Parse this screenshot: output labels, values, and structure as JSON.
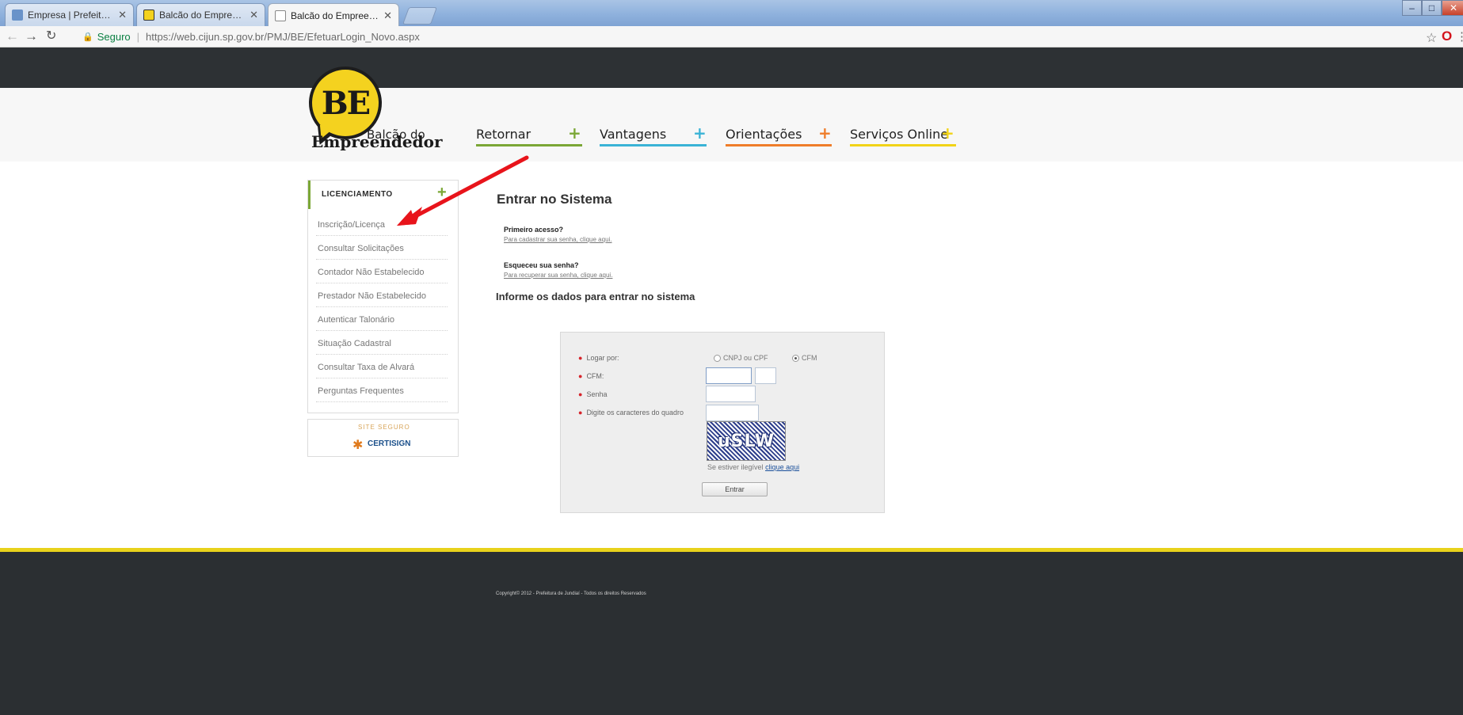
{
  "browser": {
    "tabs": [
      {
        "title": "Empresa | Prefeitura de"
      },
      {
        "title": "Balcão do Empreendedo"
      },
      {
        "title": "Balcão do Empreendedo"
      }
    ],
    "address": {
      "secure_label": "Seguro",
      "url": "https://web.cijun.sp.gov.br/PMJ/BE/EfetuarLogin_Novo.aspx"
    }
  },
  "logo": {
    "mark": "BE",
    "line1": "Balcão do",
    "line2": "Empreendedor"
  },
  "nav": {
    "items": [
      {
        "label": "Retornar",
        "color": "#7ba736"
      },
      {
        "label": "Vantagens",
        "color": "#3ab3d6"
      },
      {
        "label": "Orientações",
        "color": "#ef7d2a"
      },
      {
        "label": "Serviços Online",
        "color": "#f1d317"
      }
    ],
    "plus": "+"
  },
  "sidebar": {
    "header": "LICENCIAMENTO",
    "plus": "+",
    "items": [
      {
        "label": "Inscrição/Licença"
      },
      {
        "label": "Consultar Solicitações"
      },
      {
        "label": "Contador Não Estabelecido"
      },
      {
        "label": "Prestador Não Estabelecido"
      },
      {
        "label": "Autenticar Talonário"
      },
      {
        "label": "Situação Cadastral"
      },
      {
        "label": "Consultar Taxa de Alvará"
      },
      {
        "label": "Perguntas Frequentes"
      }
    ]
  },
  "badge": {
    "top": "SITE SEGURO",
    "name": "CERTISIGN"
  },
  "main": {
    "title": "Entrar no Sistema",
    "first_access_title": "Primeiro acesso?",
    "first_access_link": "Para cadastrar sua senha, clique aqui.",
    "forgot_title": "Esqueceu sua senha?",
    "forgot_link": "Para recuperar sua senha, clique aqui.",
    "info_title": "Informe os dados para entrar no sistema"
  },
  "login": {
    "label_logar": "Logar por:",
    "option_cnpj": "CNPJ ou CPF",
    "option_cfm": "CFM",
    "selected": "CFM",
    "label_cfm": "CFM:",
    "label_senha": "Senha",
    "label_captcha": "Digite os caracteres do quadro",
    "captcha_text": "uSLW",
    "captcha_note": "Se estiver ilegível",
    "captcha_link": "clique aqui",
    "button_enter": "Entrar"
  },
  "footer": {
    "copyright": "Copyright© 2012 - Prefeitura de Jundiaí - Todos os direitos Reservados"
  }
}
